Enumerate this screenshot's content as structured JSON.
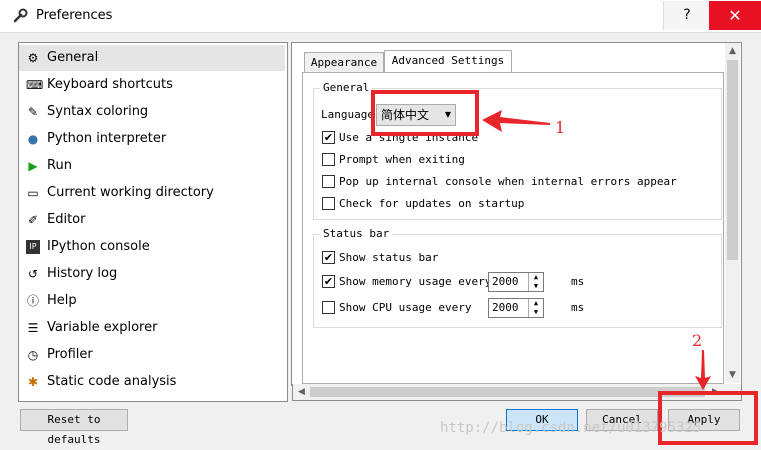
{
  "window": {
    "title": "Preferences",
    "help": "?",
    "close": "✕"
  },
  "sidebar": {
    "items": [
      {
        "label": "General",
        "icon": "gears-icon"
      },
      {
        "label": "Keyboard shortcuts",
        "icon": "keyboard-icon"
      },
      {
        "label": "Syntax coloring",
        "icon": "eyedropper-icon"
      },
      {
        "label": "Python interpreter",
        "icon": "python-icon"
      },
      {
        "label": "Run",
        "icon": "play-icon"
      },
      {
        "label": "Current working directory",
        "icon": "folder-icon"
      },
      {
        "label": "Editor",
        "icon": "editor-icon"
      },
      {
        "label": "IPython console",
        "icon": "ipython-icon"
      },
      {
        "label": "History log",
        "icon": "history-icon"
      },
      {
        "label": "Help",
        "icon": "help-icon"
      },
      {
        "label": "Variable explorer",
        "icon": "table-icon"
      },
      {
        "label": "Profiler",
        "icon": "clock-icon"
      },
      {
        "label": "Static code analysis",
        "icon": "magnifier-icon"
      }
    ]
  },
  "tabs": {
    "appearance": "Appearance",
    "advanced": "Advanced Settings"
  },
  "general_group": {
    "title": "General",
    "language_label": "Language",
    "language_value": "简体中文",
    "single_instance": "Use a single instance",
    "prompt_exit": "Prompt when exiting",
    "popup_console": "Pop up internal console when internal errors appear",
    "check_updates": "Check for updates on startup"
  },
  "status_group": {
    "title": "Status bar",
    "show_status": "Show status bar",
    "show_memory": "Show memory usage every",
    "memory_value": "2000",
    "memory_unit": "ms",
    "show_cpu": "Show CPU usage every",
    "cpu_value": "2000",
    "cpu_unit": "ms"
  },
  "buttons": {
    "reset": "Reset to defaults",
    "ok": "OK",
    "cancel": "Cancel",
    "apply": "Apply"
  },
  "annotations": {
    "one": "1",
    "two": "2"
  },
  "watermark": "http://blog.csdn.net/u013795325",
  "colors": {
    "annotation": "#e8262a",
    "close": "#e81123"
  }
}
